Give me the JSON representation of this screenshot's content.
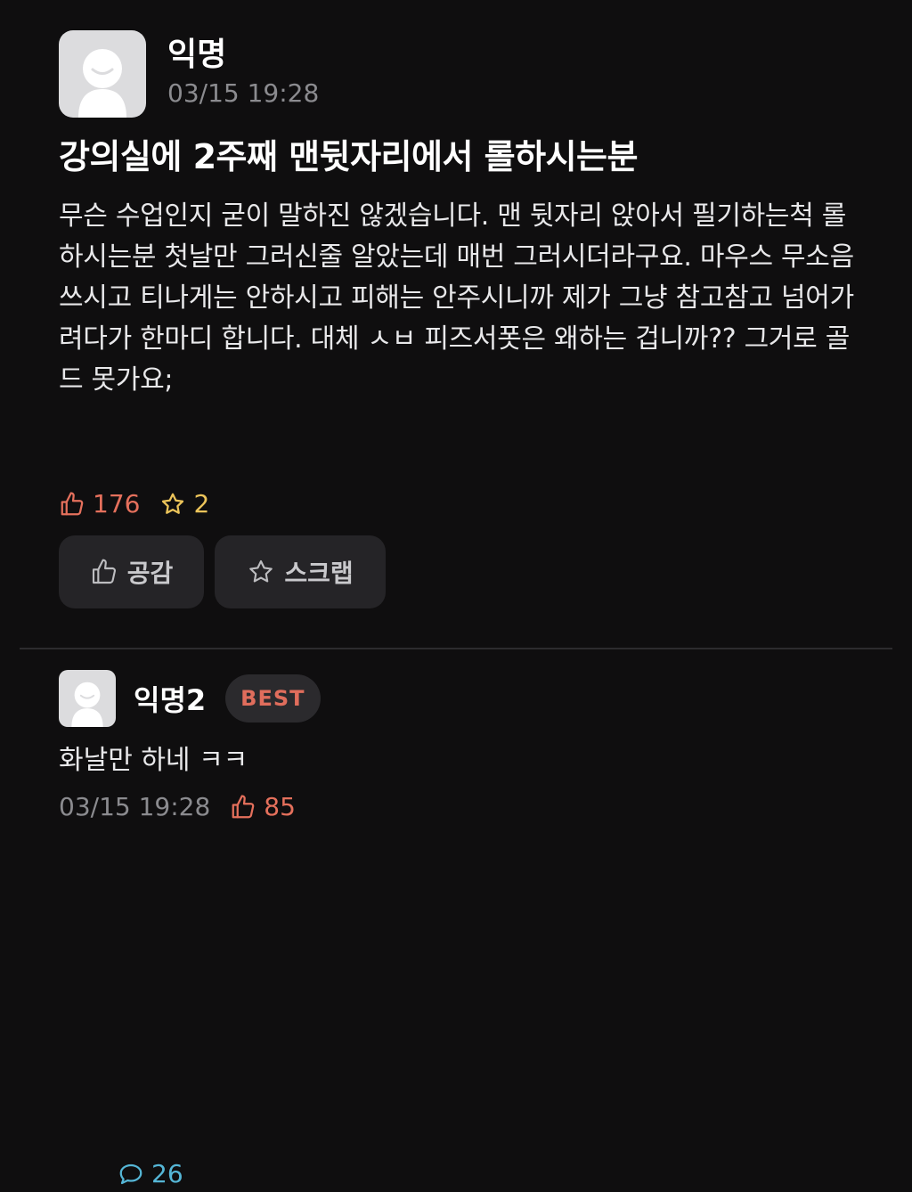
{
  "post": {
    "author": "익명",
    "time": "03/15 19:28",
    "title": "강의실에 2주째 맨뒷자리에서 롤하시는분",
    "body": "무슨 수업인지 굳이 말하진 않겠습니다. 맨 뒷자리 앉아서 필기하는척 롤하시는분 첫날만 그러신줄 알았는데 매번 그러시더라구요. 마우스 무소음 쓰시고 티나게는 안하시고 피해는 안주시니까 제가 그냥 참고참고 넘어가려다가 한마디 합니다. 대체 ㅅㅂ 피즈서폿은 왜하는 겁니까?? 그거로 골드 못가요;",
    "stats": {
      "likes": "176",
      "comments": "26",
      "scraps": "2"
    },
    "actions": {
      "like_label": "공감",
      "scrap_label": "스크랩"
    }
  },
  "comment": {
    "author": "익명2",
    "badge": "BEST",
    "text": "화날만 하네 ㅋㅋ",
    "time": "03/15 19:28",
    "likes": "85"
  },
  "icons": {
    "avatar": "anonymous-avatar-icon",
    "like": "thumbs-up-icon",
    "comment": "speech-bubble-icon",
    "scrap": "star-icon"
  },
  "colors": {
    "background": "#0f0e0f",
    "like": "#e5705c",
    "comment": "#55b6d6",
    "scrap": "#ecc45a",
    "badge": "#e06d5c"
  }
}
